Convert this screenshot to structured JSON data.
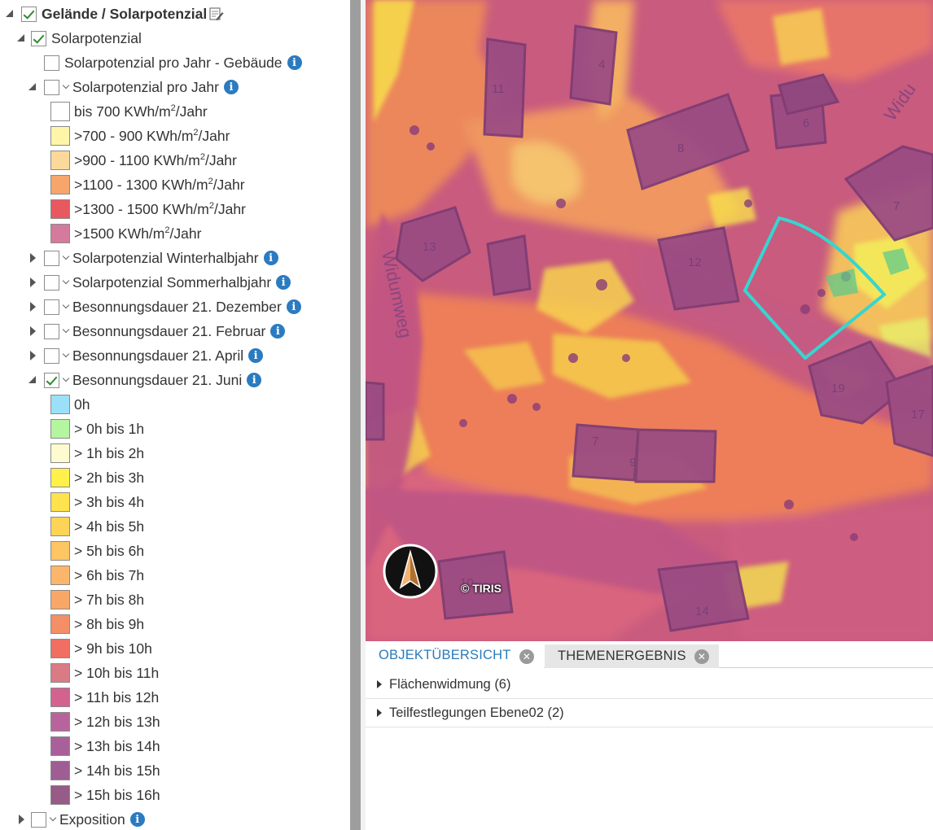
{
  "tree": {
    "root_label": "Gelände / Solarpotenzial",
    "group_label": "Solarpotenzial",
    "layer_gebaeude": "Solarpotenzial pro Jahr - Gebäude",
    "layer_jahr": "Solarpotenzial pro Jahr",
    "jahr_legend": [
      {
        "pre": "bis 700 KWh/m",
        "post": "/Jahr",
        "color": "#ffffff"
      },
      {
        "pre": ">700 - 900 KWh/m",
        "post": "/Jahr",
        "color": "#fff5a8"
      },
      {
        "pre": ">900 - 1100 KWh/m",
        "post": "/Jahr",
        "color": "#fcd89b"
      },
      {
        "pre": ">1100 - 1300 KWh/m",
        "post": "/Jahr",
        "color": "#f6a56b"
      },
      {
        "pre": ">1300 - 1500 KWh/m",
        "post": "/Jahr",
        "color": "#e8585f"
      },
      {
        "pre": ">1500 KWh/m",
        "post": "/Jahr",
        "color": "#d47a9c"
      }
    ],
    "sup2": "2",
    "layer_winter": "Solarpotenzial Winterhalbjahr",
    "layer_sommer": "Solarpotenzial Sommerhalbjahr",
    "layer_dez": "Besonnungsdauer 21. Dezember",
    "layer_feb": "Besonnungsdauer 21. Februar",
    "layer_apr": "Besonnungsdauer 21. April",
    "layer_jun": "Besonnungsdauer 21. Juni",
    "jun_legend": [
      {
        "label": "0h",
        "color": "#9be0f8"
      },
      {
        "label": "> 0h bis 1h",
        "color": "#b4f5a0"
      },
      {
        "label": "> 1h bis 2h",
        "color": "#fffbd0"
      },
      {
        "label": "> 2h bis 3h",
        "color": "#fff14a"
      },
      {
        "label": "> 3h bis 4h",
        "color": "#ffe24d"
      },
      {
        "label": "> 4h bis 5h",
        "color": "#fed457"
      },
      {
        "label": "> 5h bis 6h",
        "color": "#fdc564"
      },
      {
        "label": "> 6h bis 7h",
        "color": "#fbb66b"
      },
      {
        "label": "> 7h bis 8h",
        "color": "#f8a768"
      },
      {
        "label": "> 8h bis 9h",
        "color": "#f48e67"
      },
      {
        "label": "> 9h bis 10h",
        "color": "#f06e62"
      },
      {
        "label": "> 10h bis 11h",
        "color": "#d97b85"
      },
      {
        "label": "> 11h bis 12h",
        "color": "#d4628f"
      },
      {
        "label": "> 12h bis 13h",
        "color": "#b8649c"
      },
      {
        "label": "> 13h bis 14h",
        "color": "#a9609a"
      },
      {
        "label": "> 14h bis 15h",
        "color": "#9e5e94"
      },
      {
        "label": "> 15h bis 16h",
        "color": "#965b86"
      }
    ],
    "layer_expo": "Exposition"
  },
  "map": {
    "copyright": "© TIRIS",
    "house_numbers": [
      "4",
      "11",
      "6",
      "8",
      "7",
      "13",
      "12",
      "19",
      "17",
      "7",
      "9",
      "10",
      "14"
    ],
    "street_left": "Widumweg",
    "street_top": "Widu",
    "selection_color": "#35d6d0"
  },
  "panel": {
    "tab_active": "OBJEKTÜBERSICHT",
    "tab_inactive": "THEMENERGEBNIS",
    "close_glyph": "✕",
    "rows": [
      "Flächenwidmung (6)",
      "Teilfestlegungen Ebene02 (2)"
    ]
  }
}
